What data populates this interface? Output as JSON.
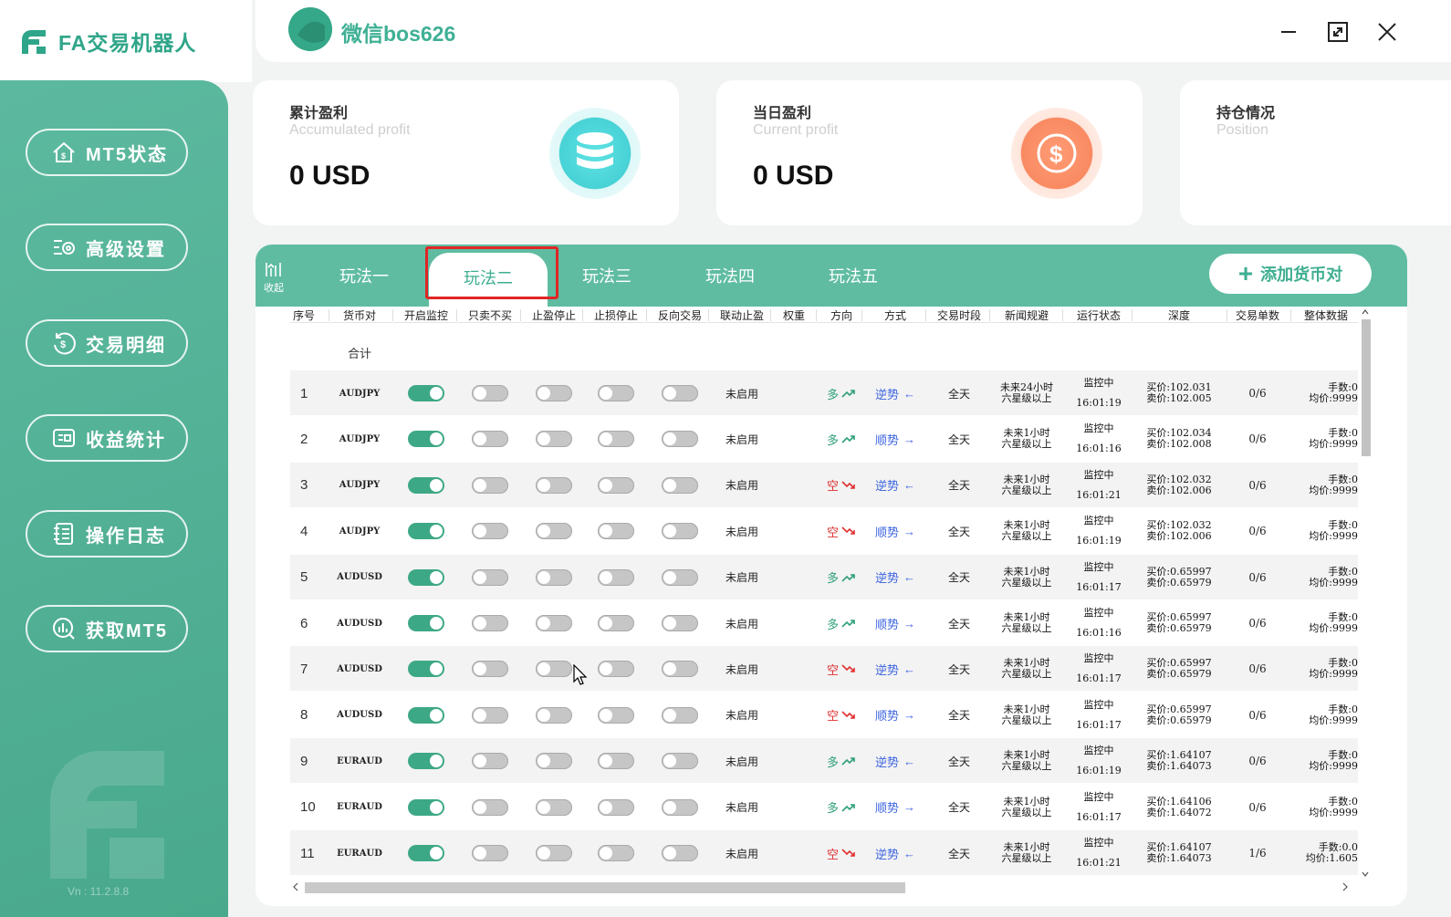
{
  "app": {
    "logo_text": "FA交易机器人",
    "title": "微信bos626",
    "version": "Vn : 11.2.8.8"
  },
  "sidebar": {
    "items": [
      {
        "label": "MT5状态",
        "icon": "house-icon"
      },
      {
        "label": "高级设置",
        "icon": "settings-icon"
      },
      {
        "label": "交易明细",
        "icon": "dollar-cycle-icon"
      },
      {
        "label": "收益统计",
        "icon": "wallet-icon"
      },
      {
        "label": "操作日志",
        "icon": "log-icon"
      },
      {
        "label": "获取MT5",
        "icon": "chart-circle-icon"
      }
    ]
  },
  "cards": [
    {
      "title": "累计盈利",
      "subtitle": "Accumulated profit",
      "value": "0 USD",
      "icon": "coins-icon",
      "color": "#5ee3e3"
    },
    {
      "title": "当日盈利",
      "subtitle": "Current profit",
      "value": "0 USD",
      "icon": "dollar-icon",
      "color": "#ff9c76"
    },
    {
      "title": "持仓情况",
      "subtitle": "Position"
    }
  ],
  "collapse_label": "收起",
  "tabs": [
    "玩法一",
    "玩法二",
    "玩法三",
    "玩法四",
    "玩法五"
  ],
  "active_tab": 1,
  "add_button": "添加货币对",
  "table": {
    "headers": [
      "序号",
      "货币对",
      "开启监控",
      "只卖不买",
      "止盈停止",
      "止损停止",
      "反向交易",
      "联动止盈",
      "权重",
      "方向",
      "方式",
      "交易时段",
      "新闻规避",
      "运行状态",
      "深度",
      "交易单数",
      "整体数据"
    ],
    "sum_label": "合计",
    "rows": [
      {
        "idx": "1",
        "pair": "AUDJPY",
        "mon": true,
        "linked": "未启用",
        "dir": "多",
        "dir_up": true,
        "mode": "逆势",
        "mode_arrow": "←",
        "session": "全天",
        "news1": "未来24小时",
        "news2": "六星级以上",
        "status": "监控中",
        "time": "16:01:19",
        "buy": "买价:102.031",
        "sell": "卖价:102.005",
        "orders": "0/6",
        "lots": "手数:0",
        "avg": "均价:9999"
      },
      {
        "idx": "2",
        "pair": "AUDJPY",
        "mon": true,
        "linked": "未启用",
        "dir": "多",
        "dir_up": true,
        "mode": "顺势",
        "mode_arrow": "→",
        "session": "全天",
        "news1": "未来1小时",
        "news2": "六星级以上",
        "status": "监控中",
        "time": "16:01:16",
        "buy": "买价:102.034",
        "sell": "卖价:102.008",
        "orders": "0/6",
        "lots": "手数:0",
        "avg": "均价:9999"
      },
      {
        "idx": "3",
        "pair": "AUDJPY",
        "mon": true,
        "linked": "未启用",
        "dir": "空",
        "dir_up": false,
        "mode": "逆势",
        "mode_arrow": "←",
        "session": "全天",
        "news1": "未来1小时",
        "news2": "六星级以上",
        "status": "监控中",
        "time": "16:01:21",
        "buy": "买价:102.032",
        "sell": "卖价:102.006",
        "orders": "0/6",
        "lots": "手数:0",
        "avg": "均价:9999"
      },
      {
        "idx": "4",
        "pair": "AUDJPY",
        "mon": true,
        "linked": "未启用",
        "dir": "空",
        "dir_up": false,
        "mode": "顺势",
        "mode_arrow": "→",
        "session": "全天",
        "news1": "未来1小时",
        "news2": "六星级以上",
        "status": "监控中",
        "time": "16:01:19",
        "buy": "买价:102.032",
        "sell": "卖价:102.006",
        "orders": "0/6",
        "lots": "手数:0",
        "avg": "均价:9999"
      },
      {
        "idx": "5",
        "pair": "AUDUSD",
        "mon": true,
        "linked": "未启用",
        "dir": "多",
        "dir_up": true,
        "mode": "逆势",
        "mode_arrow": "←",
        "session": "全天",
        "news1": "未来1小时",
        "news2": "六星级以上",
        "status": "监控中",
        "time": "16:01:17",
        "buy": "买价:0.65997",
        "sell": "卖价:0.65979",
        "orders": "0/6",
        "lots": "手数:0",
        "avg": "均价:9999"
      },
      {
        "idx": "6",
        "pair": "AUDUSD",
        "mon": true,
        "linked": "未启用",
        "dir": "多",
        "dir_up": true,
        "mode": "顺势",
        "mode_arrow": "→",
        "session": "全天",
        "news1": "未来1小时",
        "news2": "六星级以上",
        "status": "监控中",
        "time": "16:01:16",
        "buy": "买价:0.65997",
        "sell": "卖价:0.65979",
        "orders": "0/6",
        "lots": "手数:0",
        "avg": "均价:9999"
      },
      {
        "idx": "7",
        "pair": "AUDUSD",
        "mon": true,
        "linked": "未启用",
        "dir": "空",
        "dir_up": false,
        "mode": "逆势",
        "mode_arrow": "←",
        "session": "全天",
        "news1": "未来1小时",
        "news2": "六星级以上",
        "status": "监控中",
        "time": "16:01:17",
        "buy": "买价:0.65997",
        "sell": "卖价:0.65979",
        "orders": "0/6",
        "lots": "手数:0",
        "avg": "均价:9999"
      },
      {
        "idx": "8",
        "pair": "AUDUSD",
        "mon": true,
        "linked": "未启用",
        "dir": "空",
        "dir_up": false,
        "mode": "顺势",
        "mode_arrow": "→",
        "session": "全天",
        "news1": "未来1小时",
        "news2": "六星级以上",
        "status": "监控中",
        "time": "16:01:17",
        "buy": "买价:0.65997",
        "sell": "卖价:0.65979",
        "orders": "0/6",
        "lots": "手数:0",
        "avg": "均价:9999"
      },
      {
        "idx": "9",
        "pair": "EURAUD",
        "mon": true,
        "linked": "未启用",
        "dir": "多",
        "dir_up": true,
        "mode": "逆势",
        "mode_arrow": "←",
        "session": "全天",
        "news1": "未来1小时",
        "news2": "六星级以上",
        "status": "监控中",
        "time": "16:01:19",
        "buy": "买价:1.64107",
        "sell": "卖价:1.64073",
        "orders": "0/6",
        "lots": "手数:0",
        "avg": "均价:9999"
      },
      {
        "idx": "10",
        "pair": "EURAUD",
        "mon": true,
        "linked": "未启用",
        "dir": "多",
        "dir_up": true,
        "mode": "顺势",
        "mode_arrow": "→",
        "session": "全天",
        "news1": "未来1小时",
        "news2": "六星级以上",
        "status": "监控中",
        "time": "16:01:17",
        "buy": "买价:1.64106",
        "sell": "卖价:1.64072",
        "orders": "0/6",
        "lots": "手数:0",
        "avg": "均价:9999"
      },
      {
        "idx": "11",
        "pair": "EURAUD",
        "mon": true,
        "linked": "未启用",
        "dir": "空",
        "dir_up": false,
        "mode": "逆势",
        "mode_arrow": "←",
        "session": "全天",
        "news1": "未来1小时",
        "news2": "六星级以上",
        "status": "监控中",
        "time": "16:01:21",
        "buy": "买价:1.64107",
        "sell": "卖价:1.64073",
        "orders": "1/6",
        "lots": "手数:0.0",
        "avg": "均价:1.605"
      }
    ]
  }
}
